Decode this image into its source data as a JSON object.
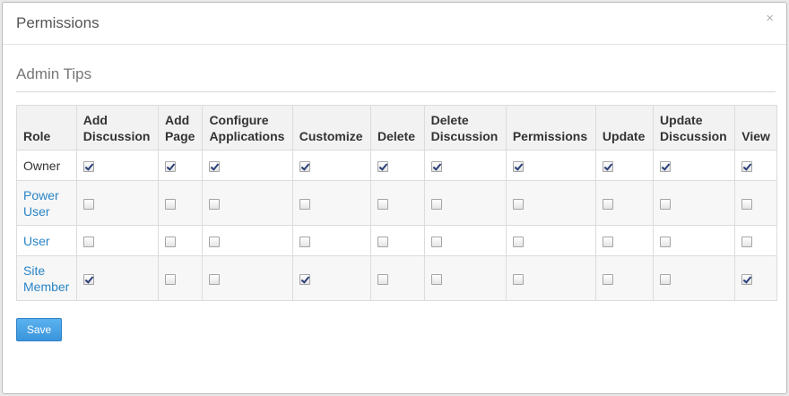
{
  "dialog": {
    "title": "Permissions",
    "close_symbol": "×"
  },
  "section": {
    "title": "Admin Tips"
  },
  "table": {
    "headers": {
      "role": "Role",
      "add_discussion": "Add Discussion",
      "add_page": "Add Page",
      "configure_applications": "Configure Applications",
      "customize": "Customize",
      "delete": "Delete",
      "delete_discussion": "Delete Discussion",
      "permissions": "Permissions",
      "update": "Update",
      "update_discussion": "Update Discussion",
      "view": "View"
    },
    "rows": [
      {
        "role": "Owner",
        "link": false,
        "checks": [
          true,
          true,
          true,
          true,
          true,
          true,
          true,
          true,
          true,
          true
        ]
      },
      {
        "role": "Power User",
        "link": true,
        "checks": [
          false,
          false,
          false,
          false,
          false,
          false,
          false,
          false,
          false,
          false
        ]
      },
      {
        "role": "User",
        "link": true,
        "checks": [
          false,
          false,
          false,
          false,
          false,
          false,
          false,
          false,
          false,
          false
        ]
      },
      {
        "role": "Site Member",
        "link": true,
        "checks": [
          true,
          false,
          false,
          true,
          false,
          false,
          false,
          false,
          false,
          true
        ]
      }
    ]
  },
  "actions": {
    "save_label": "Save"
  },
  "colors": {
    "link": "#2a85c6",
    "save_button": "#4aa3e6",
    "header_bg": "#f2f2f2"
  }
}
